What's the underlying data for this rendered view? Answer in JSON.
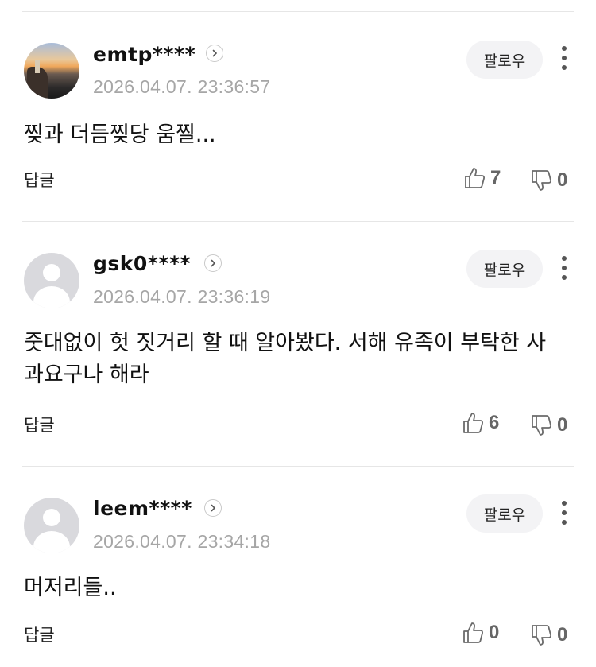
{
  "comments": [
    {
      "username": "emtp****",
      "timestamp": "2026.04.07. 23:36:57",
      "text": "찢과 더듬찢당 움찔...",
      "reply_label": "답글",
      "likes": "7",
      "dislikes": "0",
      "follow_label": "팔로우",
      "avatar": "photo"
    },
    {
      "username": "gsk0****",
      "timestamp": "2026.04.07. 23:36:19",
      "text": "줏대없이 헛 짓거리 할 때 알아봤다. 서해 유족이 부탁한 사과요구나 해라",
      "reply_label": "답글",
      "likes": "6",
      "dislikes": "0",
      "follow_label": "팔로우",
      "avatar": "default"
    },
    {
      "username": "leem****",
      "timestamp": "2026.04.07. 23:34:18",
      "text": "머저리들..",
      "reply_label": "답글",
      "likes": "0",
      "dislikes": "0",
      "follow_label": "팔로우",
      "avatar": "default"
    }
  ],
  "icons": {
    "profile_link": "chevron-right-circle-icon",
    "more": "more-vertical-icon",
    "like": "thumbs-up-icon",
    "dislike": "thumbs-down-icon"
  }
}
